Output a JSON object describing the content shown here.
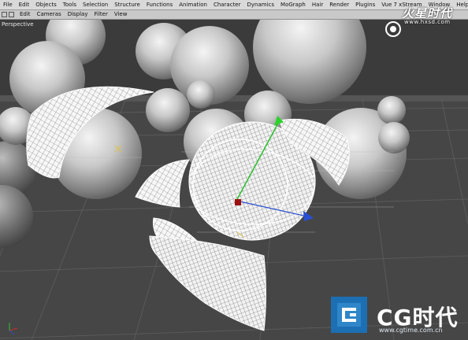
{
  "menubar": {
    "items": [
      "File",
      "Edit",
      "Objects",
      "Tools",
      "Selection",
      "Structure",
      "Functions",
      "Animation",
      "Character",
      "Dynamics",
      "MoGraph",
      "Hair",
      "Render",
      "Plugins",
      "Vue 7 xStream",
      "Window",
      "Help"
    ]
  },
  "view_menu": {
    "items": [
      "Edit",
      "Cameras",
      "Display",
      "Filter",
      "View"
    ]
  },
  "viewport": {
    "label": "Perspective"
  },
  "watermark_top": {
    "title": "火星时代",
    "url": "www.hxsd.com"
  },
  "watermark_bottom": {
    "brand": "CG时代",
    "url": "www.cgtime.com.cn"
  },
  "colors": {
    "menubar_bg": "#d9d9d9",
    "viewport_bg": "#3a3a3a",
    "sphere_light": "#f2f2f2",
    "sphere_dark": "#6a6a6a",
    "logo_blue": "#2f86c9"
  }
}
